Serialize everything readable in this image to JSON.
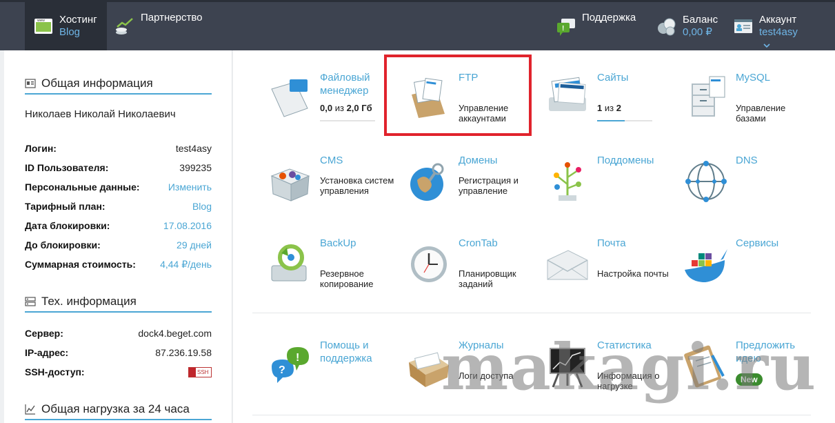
{
  "topbar": {
    "hosting": {
      "label": "Хостинг",
      "sub": "Blog"
    },
    "partner": {
      "label": "Партнерство"
    },
    "support": {
      "label": "Поддержка"
    },
    "balance": {
      "label": "Баланс",
      "sub": "0,00 ₽"
    },
    "account": {
      "label": "Аккаунт",
      "sub": "test4asy"
    }
  },
  "sidebar": {
    "general_title": "Общая информация",
    "user_name": "Николаев Николай Николаевич",
    "rows": [
      {
        "label": "Логин:",
        "value": "test4asy"
      },
      {
        "label": "ID Пользователя:",
        "value": "399235"
      },
      {
        "label": "Персональные данные:",
        "value": "Изменить"
      },
      {
        "label": "Тарифный план:",
        "value": "Blog"
      },
      {
        "label": "Дата блокировки:",
        "value": "17.08.2016"
      },
      {
        "label": "До блокировки:",
        "value": "29 дней"
      },
      {
        "label": "Суммарная стоимость:",
        "value": "4,44 ₽/день"
      }
    ],
    "tech_title": "Тех. информация",
    "tech_rows": [
      {
        "label": "Сервер:",
        "value": "dock4.beget.com"
      },
      {
        "label": "IP-адрес:",
        "value": "87.236.19.58"
      },
      {
        "label": "SSH-доступ:",
        "value": "SSH"
      }
    ],
    "load_title": "Общая нагрузка за 24 часа"
  },
  "tiles": {
    "filemanager": {
      "title": "Файловый менеджер",
      "used": "0,0",
      "of": "из",
      "total": "2,0 Гб"
    },
    "ftp": {
      "title": "FTP",
      "desc": "Управление аккаунтами"
    },
    "sites": {
      "title": "Сайты",
      "used": "1",
      "of": "из",
      "total": "2",
      "fill": 0.5
    },
    "mysql": {
      "title": "MySQL",
      "desc": "Управление базами"
    },
    "cms": {
      "title": "CMS",
      "desc": "Установка систем управления"
    },
    "domains": {
      "title": "Домены",
      "desc": "Регистрация и управление"
    },
    "subdomains": {
      "title": "Поддомены"
    },
    "dns": {
      "title": "DNS"
    },
    "backup": {
      "title": "BackUp",
      "desc": "Резервное копирование"
    },
    "crontab": {
      "title": "CronTab",
      "desc": "Планировщик заданий"
    },
    "mail": {
      "title": "Почта",
      "desc": "Настройка почты"
    },
    "services": {
      "title": "Сервисы"
    },
    "help": {
      "title": "Помощь и поддержка"
    },
    "logs": {
      "title": "Журналы",
      "desc": "Логи доступа"
    },
    "stats": {
      "title": "Статистика",
      "desc": "Информация о нагрузке"
    },
    "idea": {
      "title": "Предложить идею",
      "badge": "New"
    }
  },
  "watermark": "makagi.ru",
  "colors": {
    "accent": "#4aa6d4",
    "topbar": "#3d4350",
    "highlight": "#e0232c",
    "new_badge": "#3b8c2e"
  }
}
